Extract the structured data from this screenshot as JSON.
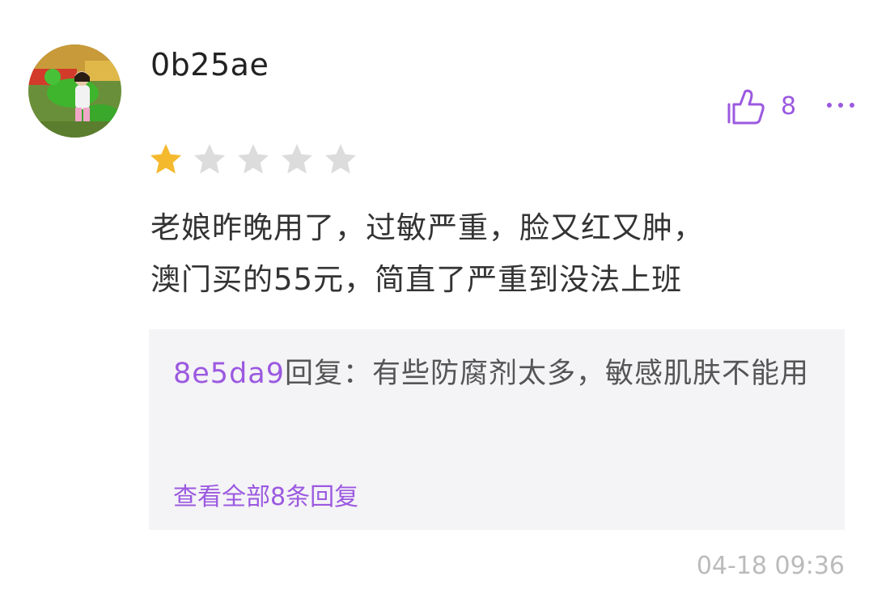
{
  "comment": {
    "username": "0b25ae",
    "like_count": "8",
    "rating": 1,
    "rating_max": 5,
    "text_line1": "老娘昨晚用了，过敏严重，脸又红又肿，",
    "text_line2": "澳门买的55元，简直了严重到没法上班",
    "timestamp": "04-18 09:36"
  },
  "reply": {
    "user": "8e5da9",
    "text": "回复：有些防腐剂太多，敏感肌肤不能用",
    "view_all": "查看全部8条回复"
  },
  "colors": {
    "accent": "#9b59e0",
    "star_filled": "#f5b92e",
    "star_empty": "#dcdcdc",
    "reply_bg": "#f4f3f6"
  },
  "icons": {
    "like": "thumbs-up-icon",
    "more": "more-dots-icon",
    "star": "star-icon"
  }
}
